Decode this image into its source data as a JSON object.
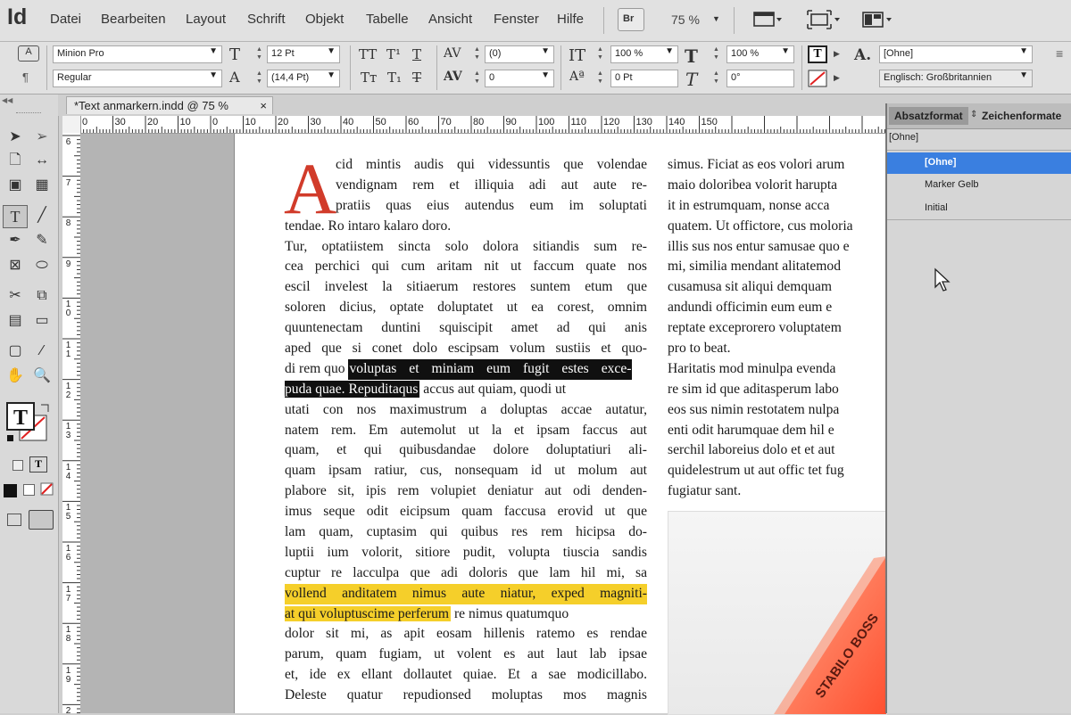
{
  "app": {
    "logo": "Id"
  },
  "menu": [
    "Datei",
    "Bearbeiten",
    "Layout",
    "Schrift",
    "Objekt",
    "Tabelle",
    "Ansicht",
    "Fenster",
    "Hilfe"
  ],
  "toolbar_top": {
    "bridge": "Br",
    "zoom": "75 %"
  },
  "control": {
    "font_family": "Minion Pro",
    "font_style": "Regular",
    "font_size": "12 Pt",
    "leading": "(14,4 Pt)",
    "kerning": "(0)",
    "tracking": "0",
    "vscale": "100 %",
    "hscale": "100 %",
    "baseline": "0 Pt",
    "skew": "0°",
    "char_style": "[Ohne]",
    "language": "Englisch: Großbritannien"
  },
  "document": {
    "tab_title": "*Text anmarkern.indd @ 75 %",
    "close": "×",
    "hruler_labels": [
      "0",
      "30",
      "20",
      "10",
      "0",
      "10",
      "20",
      "30",
      "40",
      "50",
      "60",
      "70",
      "80",
      "90",
      "100",
      "110",
      "120",
      "130",
      "140",
      "150"
    ],
    "vruler_labels": [
      "6",
      "7",
      "8",
      "9",
      "10",
      "11",
      "12",
      "13",
      "14",
      "15",
      "16",
      "17",
      "18",
      "19",
      "20"
    ],
    "dropcap": "A",
    "col1_lines": [
      "cid mintis audis qui videssuntis que volendae",
      "vendignam rem et illiquia adi aut aute re-",
      "pratiis quas eius autendus eum im soluptati",
      "tendae. Ro intaro kalaro doro.",
      "Tur, optatiistem sincta solo dolora sitiandis sum re-",
      "cea perchici qui cum aritam nit ut faccum quate nos",
      "escil invelest la sitiaerum restores suntem etum que",
      "soloren dicius, optate doluptatet ut ea corest, omnim",
      "quuntenectam duntini squiscipit amet ad qui anis",
      "aped que si conet dolo escipsam volum sustiis et quo-",
      "di rem quo ",
      "voluptas et miniam eum fugit estes exce-",
      "puda quae. Repuditaqus",
      " accus aut quiam, quodi ut",
      "utati con nos maximustrum a doluptas accae autatur,",
      "natem rem. Em autemolut ut la et ipsam faccus aut",
      "quam, et qui quibusdandae dolore doluptatiuri ali-",
      "quam ipsam ratiur, cus, nonsequam id ut molum aut",
      "plabore sit, ipis rem volupiet deniatur aut odi denden-",
      "imus seque odit eicipsum quam faccusa erovid ut que",
      "lam quam, cuptasim qui quibus res rem hicipsa do-",
      "luptiі ium volorit, sitiore pudit, volupta tiuscia sandis",
      "cuptur re lacculpa que adi doloris que lam hil mi, sa",
      "vollend anditatem nimus aute niatur, exped magniti-",
      "at qui voluptuscime perferum",
      " re nimus quatumquo",
      "dolor sit mi, as apit eosam hillenis ratemo es rendae",
      "parum, quam fugiam, ut volent es aut laut lab ipsae",
      "et, ide ex ellant dollautet quiae. Et a sae modicillabo.",
      "Deleste quatur repudionsed moluptas mos magnis"
    ],
    "col2_lines": [
      "simus. Ficiat as eos volori arum",
      "maio doloribea volorit harupta",
      "it in estrumquam, nonse acca",
      "quatem. Ut offictore, cus moloria",
      "illis sus nos entur samusae quo e",
      "mi, similia mendant alitatemod",
      "cusamusa sit aliqui demquam",
      "andundi officimin eum eum e",
      "reptate exceprorero voluptatem",
      "pro to beat.",
      "Haritatis mod minulpa evenda",
      "re sim id que aditasperum labo",
      "eos sus nimin restotatem nulpa",
      "enti odit harumquae dem hil e",
      "serchil laboreius dolo et et aut",
      "quidelestrum ut aut offic tet fug",
      "fugiatur sant."
    ],
    "marker_text": "STABILO BOSS"
  },
  "panel": {
    "tab_paragraph": "Absatzformat",
    "tab_character": "Zeichenformate",
    "current": "[Ohne]",
    "items": [
      "[Ohne]",
      "Marker Gelb",
      "Initial"
    ],
    "selected_color": "#3a7fe0",
    "marker_color": "#f5cf2a"
  }
}
